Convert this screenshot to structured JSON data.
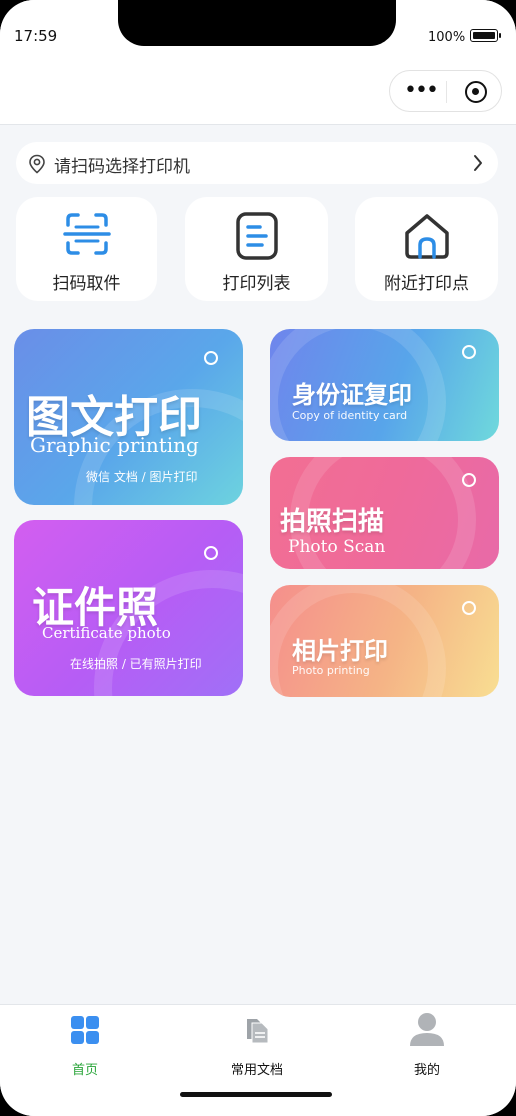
{
  "status": {
    "time": "17:59",
    "battery": "100%"
  },
  "scan_bar": {
    "text": "请扫码选择打印机"
  },
  "quick_actions": [
    {
      "label": "扫码取件",
      "icon": "scan-icon"
    },
    {
      "label": "打印列表",
      "icon": "document-list-icon"
    },
    {
      "label": "附近打印点",
      "icon": "home-location-icon"
    }
  ],
  "cards": {
    "graphic": {
      "title": "图文打印",
      "subtitle": "Graphic printing",
      "desc": "微信 文档 / 图片打印"
    },
    "certificate": {
      "title": "证件照",
      "subtitle": "Certificate photo",
      "desc": "在线拍照 / 已有照片打印"
    },
    "id_copy": {
      "title": "身份证复印",
      "subtitle": "Copy of identity card"
    },
    "photo_scan": {
      "title": "拍照扫描",
      "subtitle": "Photo Scan"
    },
    "photo_print": {
      "title": "相片打印",
      "subtitle": "Photo printing"
    }
  },
  "tabs": [
    {
      "label": "首页",
      "icon": "home-grid-icon",
      "active": true
    },
    {
      "label": "常用文档",
      "icon": "documents-icon",
      "active": false
    },
    {
      "label": "我的",
      "icon": "user-icon",
      "active": false
    }
  ],
  "colors": {
    "accent": "#3b8ff0",
    "active_tab": "#2aa53a",
    "background": "#f4f6f9"
  }
}
